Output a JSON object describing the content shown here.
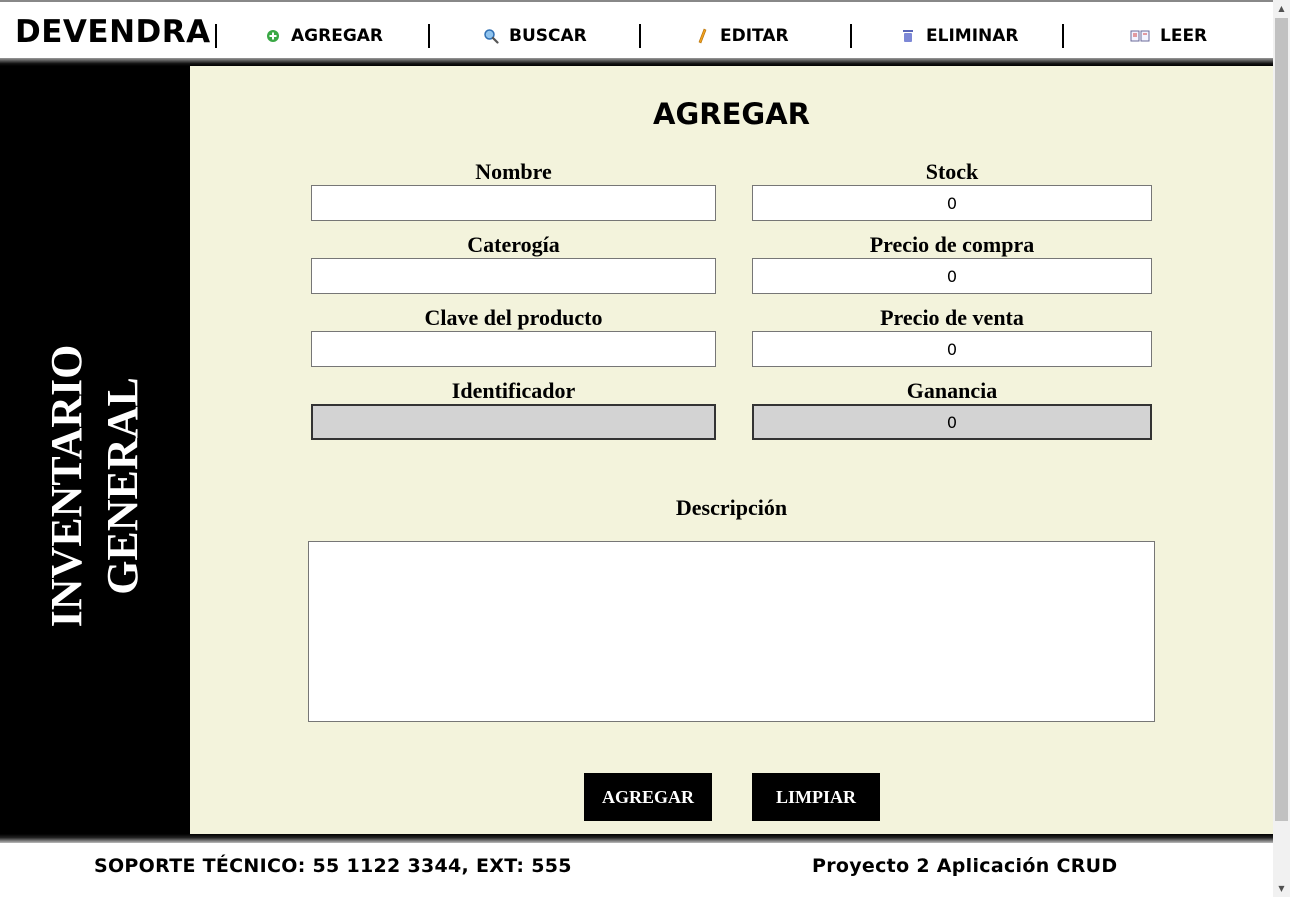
{
  "brand": "DEVENDRA",
  "nav": [
    {
      "label": "AGREGAR",
      "icon": "add-circle-icon"
    },
    {
      "label": "BUSCAR",
      "icon": "search-icon"
    },
    {
      "label": "EDITAR",
      "icon": "pencil-icon"
    },
    {
      "label": "ELIMINAR",
      "icon": "trash-icon"
    },
    {
      "label": "LEER",
      "icon": "book-icon"
    }
  ],
  "sidebar": {
    "title_line1": "INVENTARIO",
    "title_line2": "GENERAL"
  },
  "form": {
    "title": "AGREGAR",
    "nombre_label": "Nombre",
    "nombre_value": "",
    "categoria_label": "Caterogía",
    "categoria_value": "",
    "clave_label": "Clave del producto",
    "clave_value": "",
    "identificador_label": "Identificador",
    "identificador_value": "",
    "stock_label": "Stock",
    "stock_value": "0",
    "precio_compra_label": "Precio de compra",
    "precio_compra_value": "0",
    "precio_venta_label": "Precio de venta",
    "precio_venta_value": "0",
    "ganancia_label": "Ganancia",
    "ganancia_value": "0",
    "descripcion_label": "Descripción",
    "descripcion_value": "",
    "agregar_button": "AGREGAR",
    "limpiar_button": "LIMPIAR"
  },
  "footer": {
    "support": "SOPORTE TÉCNICO: 55 1122 3344, EXT: 555",
    "project": "Proyecto 2 Aplicación CRUD"
  },
  "colors": {
    "panel_bg": "#f3f3dc",
    "sidebar_bg": "#000000",
    "button_bg": "#000000"
  }
}
